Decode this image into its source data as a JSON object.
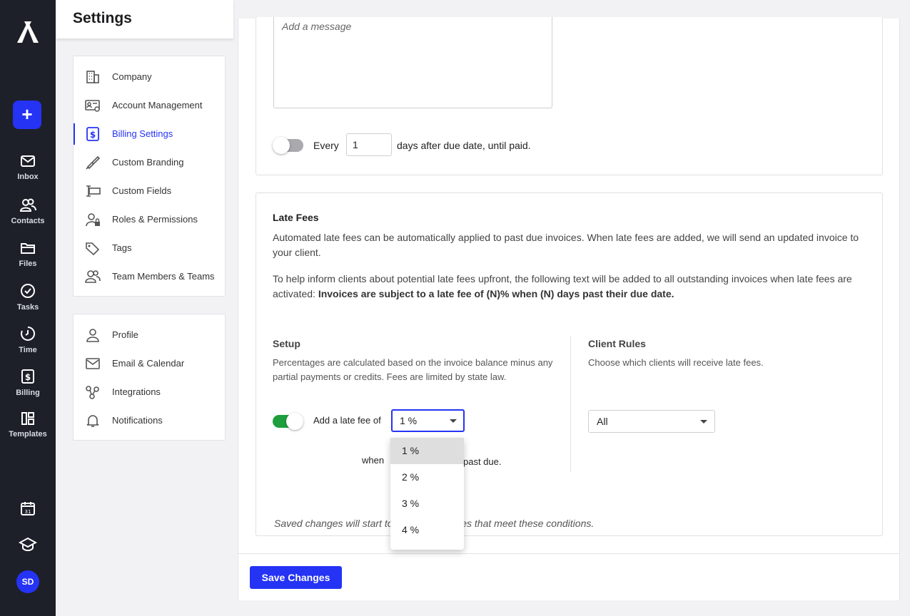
{
  "rail": {
    "items": [
      {
        "label": "Inbox",
        "icon": "mail-icon"
      },
      {
        "label": "Contacts",
        "icon": "contacts-icon"
      },
      {
        "label": "Files",
        "icon": "folder-icon"
      },
      {
        "label": "Tasks",
        "icon": "check-circle-icon"
      },
      {
        "label": "Time",
        "icon": "clock-icon"
      },
      {
        "label": "Billing",
        "icon": "billing-icon"
      },
      {
        "label": "Templates",
        "icon": "templates-icon"
      }
    ],
    "avatar_initials": "SD"
  },
  "settings": {
    "title": "Settings",
    "nav_primary": [
      {
        "label": "Company"
      },
      {
        "label": "Account Management"
      },
      {
        "label": "Billing Settings"
      },
      {
        "label": "Custom Branding"
      },
      {
        "label": "Custom Fields"
      },
      {
        "label": "Roles & Permissions"
      },
      {
        "label": "Tags"
      },
      {
        "label": "Team Members & Teams"
      }
    ],
    "nav_secondary": [
      {
        "label": "Profile"
      },
      {
        "label": "Email & Calendar"
      },
      {
        "label": "Integrations"
      },
      {
        "label": "Notifications"
      }
    ]
  },
  "reminder": {
    "message_placeholder": "Add a message",
    "every_label": "Every",
    "days_value": "1",
    "after_label": "days after due date, until paid."
  },
  "late_fees": {
    "title": "Late Fees",
    "description": "Automated late fees can be automatically applied to past due invoices. When late fees are added, we will send an updated invoice to your client.",
    "inform_text": "To help inform clients about potential late fees upfront, the following text will be added to all outstanding invoices when late fees are activated: ",
    "inform_bold": "Invoices are subject to a late fee of (N)% when (N) days past their due date.",
    "setup": {
      "title": "Setup",
      "description": "Percentages are calculated based on the invoice balance minus any partial payments or credits. Fees are limited by state law.",
      "add_fee_label": "Add a late fee of",
      "fee_value": "1 %",
      "when_label": "when",
      "past_due_label": "past due.",
      "options": [
        "1 %",
        "2 %",
        "3 %",
        "4 %"
      ]
    },
    "client_rules": {
      "title": "Client Rules",
      "description": "Choose which clients will receive late fees.",
      "value": "All"
    },
    "footnote": "Saved changes will start to affect all invoices that meet these conditions."
  },
  "footer": {
    "save_label": "Save Changes"
  },
  "colors": {
    "accent": "#2533f5",
    "toggle_on": "#1e9e3c",
    "rail_bg": "#1d2029"
  }
}
